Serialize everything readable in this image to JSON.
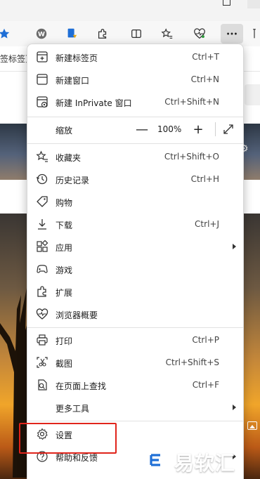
{
  "tabstrip": {
    "tab_fragment": "签标签页"
  },
  "menu": {
    "items_top": [
      {
        "label": "新建标签页",
        "shortcut": "Ctrl+T"
      },
      {
        "label": "新建窗口",
        "shortcut": "Ctrl+N"
      },
      {
        "label": "新建 InPrivate 窗口",
        "shortcut": "Ctrl+Shift+N"
      }
    ],
    "zoom": {
      "label": "缩放",
      "minus": "—",
      "value": "100%",
      "plus": "+"
    },
    "items_mid": [
      {
        "label": "收藏夹",
        "shortcut": "Ctrl+Shift+O"
      },
      {
        "label": "历史记录",
        "shortcut": "Ctrl+H"
      },
      {
        "label": "购物",
        "shortcut": ""
      },
      {
        "label": "下载",
        "shortcut": "Ctrl+J"
      },
      {
        "label": "应用",
        "shortcut": ""
      },
      {
        "label": "游戏",
        "shortcut": ""
      },
      {
        "label": "扩展",
        "shortcut": ""
      },
      {
        "label": "浏览器概要",
        "shortcut": ""
      }
    ],
    "items_tools": [
      {
        "label": "打印",
        "shortcut": "Ctrl+P"
      },
      {
        "label": "截图",
        "shortcut": "Ctrl+Shift+S"
      },
      {
        "label": "在页面上查找",
        "shortcut": "Ctrl+F"
      },
      {
        "label": "更多工具",
        "shortcut": ""
      }
    ],
    "items_bottom": [
      {
        "label": "设置",
        "shortcut": ""
      },
      {
        "label": "帮助和反馈",
        "shortcut": ""
      }
    ]
  },
  "watermark": {
    "text": "易软汇"
  },
  "colors": {
    "highlight": "#e0241b",
    "menu_bg": "#ffffff",
    "edge_blue": "#1f6fd6"
  }
}
